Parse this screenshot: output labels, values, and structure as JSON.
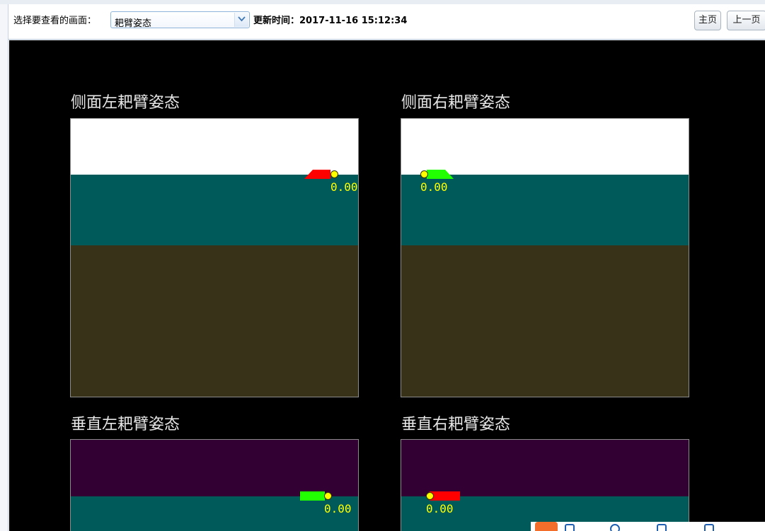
{
  "toolbar": {
    "select_label": "选择要查看的画面：",
    "selected_view": "耙臂姿态",
    "update_label": "更新时间：",
    "update_time": "2017-11-16 15:12:34",
    "home_button": "主页",
    "prev_button": "上一页"
  },
  "panels": {
    "side_left": {
      "title": "侧面左耙臂姿态",
      "value": "0.00",
      "arm_color": "#ff0000"
    },
    "side_right": {
      "title": "侧面右耙臂姿态",
      "value": "0.00",
      "arm_color": "#22ff00"
    },
    "vert_left": {
      "title": "垂直左耙臂姿态",
      "value": "0.00",
      "arm_color": "#22ff00"
    },
    "vert_right": {
      "title": "垂直右耙臂姿态",
      "value": "0.00",
      "arm_color": "#ff0000"
    }
  },
  "colors": {
    "sky": "#ffffff",
    "water": "#005a5a",
    "seabed": "#383218",
    "vertical_top": "#330033",
    "readout": "#ffff00"
  }
}
